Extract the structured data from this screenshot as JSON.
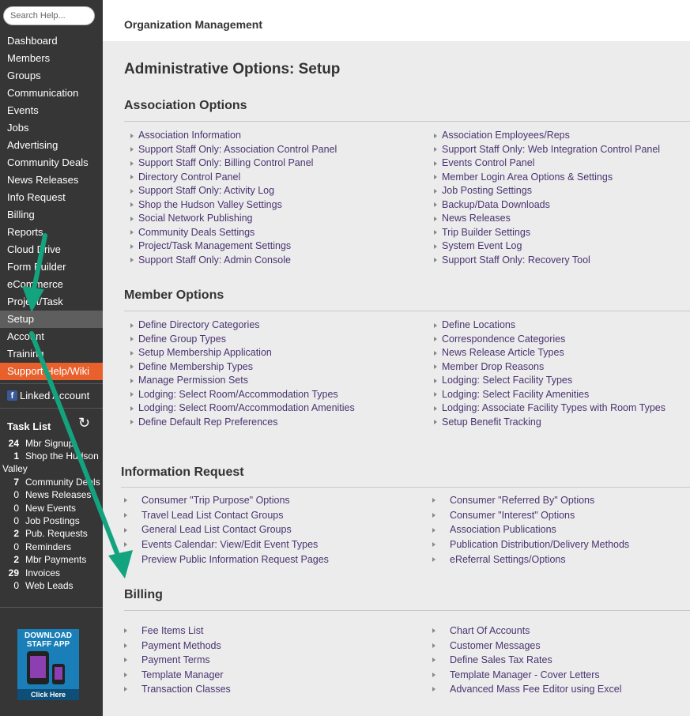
{
  "sidebar": {
    "search_placeholder": "Search Help...",
    "nav": [
      "Dashboard",
      "Members",
      "Groups",
      "Communication",
      "Events",
      "Jobs",
      "Advertising",
      "Community Deals",
      "News Releases",
      "Info Request",
      "Billing",
      "Reports",
      "Cloud Drive",
      "Form Builder",
      "eCommerce",
      "Project/Task",
      "Setup",
      "Account",
      "Training",
      "Support Help/Wiki"
    ],
    "active_item": "Setup",
    "linked_account": "Linked Account",
    "task_list": {
      "title": "Task List",
      "items": [
        {
          "count": "24",
          "label": "Mbr Signup",
          "bold": true
        },
        {
          "count": "1",
          "label": "Shop the Hudson",
          "bold": true,
          "wrap": "Valley"
        },
        {
          "count": "7",
          "label": "Community Deals",
          "bold": true
        },
        {
          "count": "0",
          "label": "News Releases",
          "bold": false
        },
        {
          "count": "0",
          "label": "New Events",
          "bold": false
        },
        {
          "count": "0",
          "label": "Job Postings",
          "bold": false
        },
        {
          "count": "2",
          "label": "Pub. Requests",
          "bold": true
        },
        {
          "count": "0",
          "label": "Reminders",
          "bold": false
        },
        {
          "count": "2",
          "label": "Mbr Payments",
          "bold": true
        },
        {
          "count": "29",
          "label": "Invoices",
          "bold": true
        },
        {
          "count": "0",
          "label": "Web Leads",
          "bold": false
        }
      ]
    },
    "app_ad": {
      "line1": "DOWNLOAD",
      "line2": "STAFF APP",
      "cta": "Click Here"
    }
  },
  "header": {
    "title": "Organization Management"
  },
  "page_title": "Administrative Options: Setup",
  "sections": {
    "association": {
      "title": "Association Options",
      "left": [
        "Association Information",
        "Support Staff Only: Association Control Panel",
        "Support Staff Only: Billing Control Panel",
        "Directory Control Panel",
        "Support Staff Only: Activity Log",
        "Shop the Hudson Valley Settings",
        "Social Network Publishing",
        "Community Deals Settings",
        "Project/Task Management Settings",
        "Support Staff Only: Admin Console"
      ],
      "right": [
        "Association Employees/Reps",
        "Support Staff Only: Web Integration Control Panel",
        "Events Control Panel",
        "Member Login Area Options & Settings",
        "Job Posting Settings",
        "Backup/Data Downloads",
        "News Releases",
        "Trip Builder Settings",
        "System Event Log",
        "Support Staff Only: Recovery Tool"
      ]
    },
    "member": {
      "title": "Member Options",
      "left": [
        "Define Directory Categories",
        "Define Group Types",
        "Setup Membership Application",
        "Define Membership Types",
        "Manage Permission Sets",
        "Lodging: Select Room/Accommodation Types",
        "Lodging: Select Room/Accommodation Amenities",
        "Define Default Rep Preferences"
      ],
      "right": [
        "Define Locations",
        "Correspondence Categories",
        "News Release Article Types",
        "Member Drop Reasons",
        "Lodging: Select Facility Types",
        "Lodging: Select Facility Amenities",
        "Lodging: Associate Facility Types with Room Types",
        "Setup Benefit Tracking"
      ]
    },
    "info_request": {
      "title": "Information Request",
      "left": [
        "Consumer \"Trip Purpose\" Options",
        "Travel Lead List Contact Groups",
        "General Lead List Contact Groups",
        "Events Calendar: View/Edit Event Types",
        "Preview Public Information Request Pages"
      ],
      "right": [
        "Consumer \"Referred By\" Options",
        "Consumer \"Interest\" Options",
        "Association Publications",
        "Publication Distribution/Delivery Methods",
        "eReferral Settings/Options"
      ]
    },
    "billing": {
      "title": "Billing",
      "left": [
        "Fee Items List",
        "Payment Methods",
        "Payment Terms",
        "Template Manager",
        "Transaction Classes"
      ],
      "right": [
        "Chart Of Accounts",
        "Customer Messages",
        "Define Sales Tax Rates",
        "Template Manager - Cover Letters",
        "Advanced Mass Fee Editor using Excel"
      ]
    }
  },
  "colors": {
    "sidebar_bg": "#363636",
    "active_bg": "#5e5e5e",
    "support_bg": "#e8612c",
    "link": "#4a3470",
    "arrow": "#14a37f"
  }
}
